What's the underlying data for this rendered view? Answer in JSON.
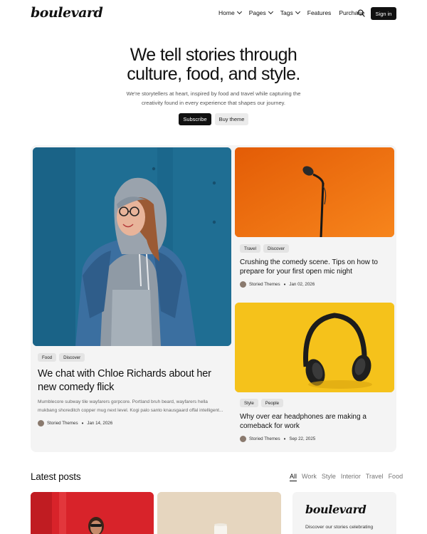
{
  "brand": {
    "logo": "boulevard"
  },
  "nav": {
    "items": [
      {
        "label": "Home",
        "has_dropdown": true
      },
      {
        "label": "Pages",
        "has_dropdown": true
      },
      {
        "label": "Tags",
        "has_dropdown": true
      },
      {
        "label": "Features",
        "has_dropdown": false
      },
      {
        "label": "Purchase",
        "has_dropdown": false
      }
    ],
    "search_icon": "search-icon",
    "signin_label": "Sign in"
  },
  "hero": {
    "title_line1": "We tell stories through",
    "title_line2": "culture, food, and style.",
    "subtitle_line1": "We're storytellers at heart, inspired by food and travel while capturing the",
    "subtitle_line2": "creativity found in every experience that shapes our journey.",
    "subscribe_label": "Subscribe",
    "buy_label": "Buy theme"
  },
  "featured": {
    "main": {
      "tags": [
        "Food",
        "Discover"
      ],
      "title_line1": "We chat with Chloe Richards about her",
      "title_line2": "new comedy flick",
      "excerpt_line1": "Mumblecore subway tile wayfarers gorpcore. Portland bruh beard, wayfarers hella",
      "excerpt_line2": "mukbang shoreditch copper mug next level. Kogi palo santo knausgaard offal intelligent...",
      "author": "Storied Themes",
      "date": "Jan 14, 2026"
    },
    "side": [
      {
        "tags": [
          "Travel",
          "Discover"
        ],
        "title_line1": "Crushing the comedy scene. Tips on how to",
        "title_line2": "prepare for your first open mic night",
        "author": "Storied Themes",
        "date": "Jan 02, 2026"
      },
      {
        "tags": [
          "Style",
          "People"
        ],
        "title_line1": "Why over ear headphones are making a",
        "title_line2": "comeback for work",
        "author": "Storied Themes",
        "date": "Sep 22, 2025"
      }
    ]
  },
  "latest": {
    "title": "Latest posts",
    "filters": [
      "All",
      "Work",
      "Style",
      "Interior",
      "Travel",
      "Food"
    ],
    "active_filter": "All",
    "side_logo": "boulevard",
    "side_text": "Discover our stories celebrating"
  },
  "colors": {
    "accent": "#111111",
    "panel_bg": "#f4f4f4",
    "orange": "#f06a0c",
    "yellow": "#f5c21b",
    "blue": "#1f6e93",
    "red": "#d8232a",
    "beige": "#e6d6bf"
  }
}
